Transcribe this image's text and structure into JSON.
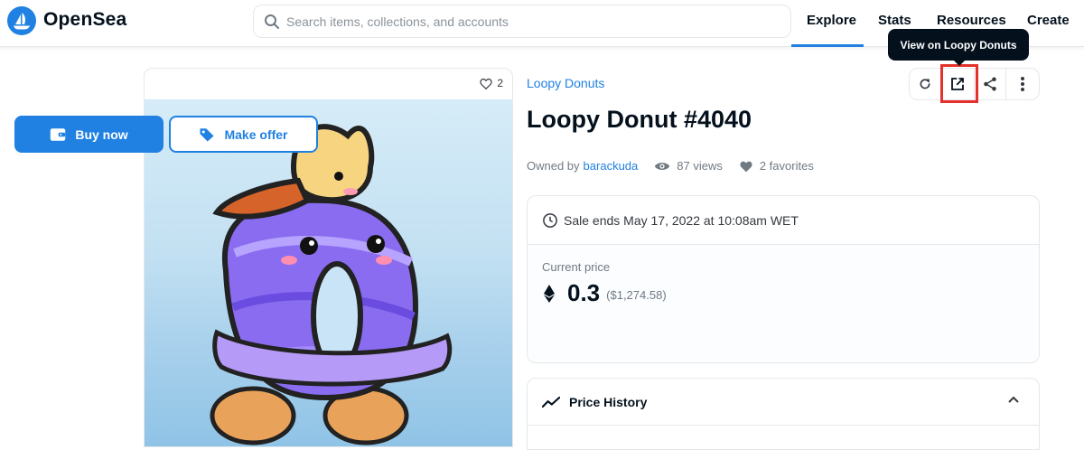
{
  "nav": {
    "brand": "OpenSea",
    "search_placeholder": "Search items, collections, and accounts",
    "links": [
      "Explore",
      "Stats",
      "Resources",
      "Create"
    ]
  },
  "asset": {
    "favorites_count": "2",
    "collection": "Loopy Donuts",
    "title": "Loopy Donut #4040",
    "owned_by_label": "Owned by",
    "owner": "barackuda",
    "views": "87 views",
    "favorites": "2 favorites"
  },
  "toolbar": {
    "tooltip": "View on Loopy Donuts",
    "icons": [
      "refresh-icon",
      "external-link-icon",
      "share-icon",
      "more-vertical-icon"
    ]
  },
  "sale": {
    "ends": "Sale ends May 17, 2022 at 10:08am WET",
    "current_price_label": "Current price",
    "price": "0.3",
    "price_usd": "($1,274.58)",
    "buy_label": "Buy now",
    "offer_label": "Make offer"
  },
  "price_history": {
    "label": "Price History"
  },
  "colors": {
    "accent": "#2081e2",
    "highlight": "#e5312b",
    "text": "#04111d"
  }
}
